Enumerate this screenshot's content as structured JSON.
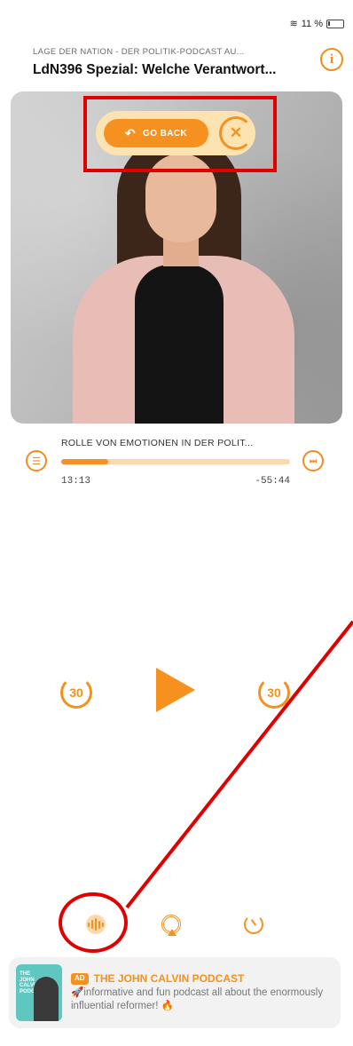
{
  "status": {
    "wifi_icon": "wifi-icon",
    "battery": "11 %"
  },
  "header": {
    "podcast_name": "LAGE DER NATION - DER POLITIK-PODCAST AU...",
    "episode_title": "LdN396 Spezial: Welche Verantwort...",
    "info_icon": "i"
  },
  "goback": {
    "label": "GO BACK",
    "icon": "↶",
    "close": "✕"
  },
  "chapter": {
    "title": "ROLLE VON EMOTIONEN IN DER POLIT...",
    "elapsed": "13:13",
    "remaining": "-55:44",
    "progress": 0.206,
    "next_icon": "⏭"
  },
  "controls": {
    "skip_back": "30",
    "skip_forward": "30"
  },
  "ad": {
    "badge": "AD",
    "title": "THE JOHN CALVIN PODCAST",
    "description": "🚀informative and fun podcast all about the enormously influential reformer! 🔥",
    "artwork_text": "THE JOHN CALVIN PODCAST"
  },
  "colors": {
    "accent": "#f6901e",
    "accent_light": "#fde2b2",
    "annotation": "#e00000"
  }
}
